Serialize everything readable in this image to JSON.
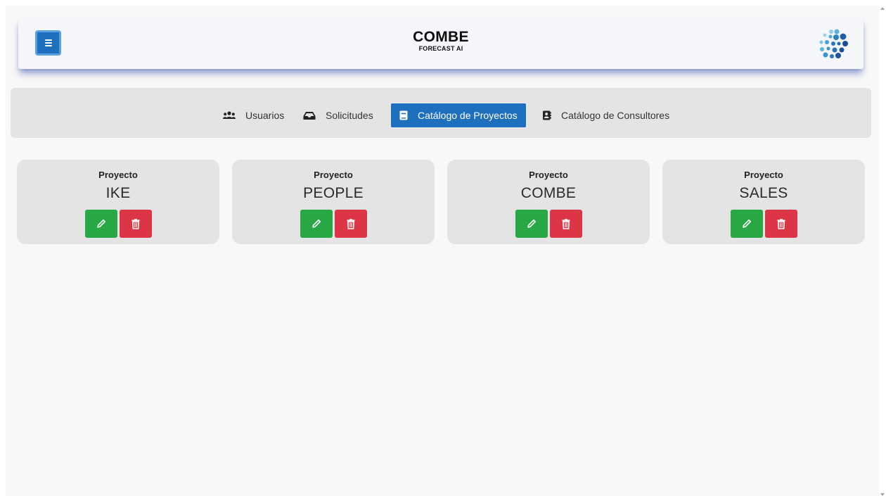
{
  "header": {
    "title": "COMBE",
    "subtitle": "FORECAST AI",
    "menu_icon": "hamburger-icon",
    "logo": "combe-dots-logo"
  },
  "nav": {
    "tabs": [
      {
        "label": "Usuarios",
        "icon": "users-icon",
        "active": false
      },
      {
        "label": "Solicitudes",
        "icon": "inbox-icon",
        "active": false
      },
      {
        "label": "Catálogo de Proyectos",
        "icon": "book-icon",
        "active": true
      },
      {
        "label": "Catálogo de Consultores",
        "icon": "address-book-icon",
        "active": false
      }
    ]
  },
  "projects": [
    {
      "label": "Proyecto",
      "name": "IKE"
    },
    {
      "label": "Proyecto",
      "name": "PEOPLE"
    },
    {
      "label": "Proyecto",
      "name": "COMBE"
    },
    {
      "label": "Proyecto",
      "name": "SALES"
    }
  ],
  "colors": {
    "primary": "#1f6fbf",
    "edit": "#28a745",
    "delete": "#dc3545",
    "panel": "#e4e4e4"
  }
}
